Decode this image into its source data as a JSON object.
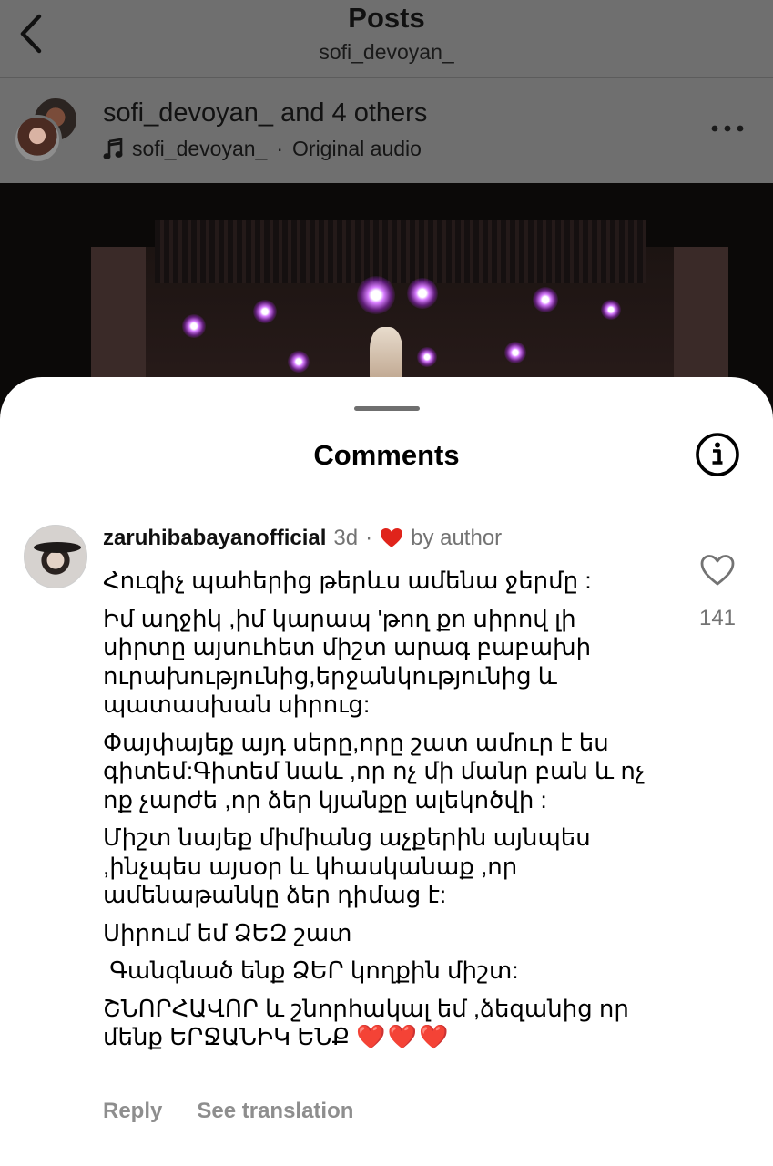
{
  "header": {
    "title": "Posts",
    "subtitle": "sofi_devoyan_"
  },
  "post": {
    "owner_name": "sofi_devoyan_",
    "owner_connector": "and",
    "owner_others": "4 others",
    "audio_user": "sofi_devoyan_",
    "audio_separator": "·",
    "audio_label": "Original audio"
  },
  "comments_sheet": {
    "title": "Comments"
  },
  "comment": {
    "username": "zaruhibabayanofficial",
    "time": "3d",
    "separator": "·",
    "by_author": "by author",
    "like_count": "141",
    "paragraphs": [
      "Հուզիչ պահերից թերևս ամենա ջերմը :",
      "Իմ աղջիկ ,իմ կարապ 'թող քո սիրով լի սիրտը այսուհետ միշտ արագ բաբախի ուրախությունից,երջանկությունից և պատասխան սիրուց:",
      "Փայփայեք այդ սերը,որը շատ ամուր է ես գիտեմ:Գիտեմ նաև ,որ ոչ մի մանր բան և ոչ ոք չարժե ,որ ձեր կյանքը ալեկոծվի :",
      "Միշտ նայեք միմիանց աչքերին այնպես ,ինչպես այսօր և կհասկանաք ,որ ամենաթանկը ձեր դիմաց է:",
      "Սիրում եմ ՁԵԶ շատ",
      " Գանգնած ենք ՁԵՐ կողքին միշտ:",
      "ՇՆՈՐՀԱՎՈՐ և շնորհակալ եմ ,ձեզանից որ մենք ԵՐՋԱՆԻԿ ԵՆՔ"
    ],
    "hearts": "❤️❤️❤️",
    "reply_label": "Reply",
    "translate_label": "See translation"
  },
  "colors": {
    "dim_overlay": "#6f6f6f",
    "heart_red": "#e0241b",
    "meta_gray": "#737373"
  },
  "icons": [
    "back-arrow-icon",
    "music-note-icon",
    "more-options-icon",
    "info-icon",
    "heart-filled-icon",
    "heart-outline-icon"
  ]
}
